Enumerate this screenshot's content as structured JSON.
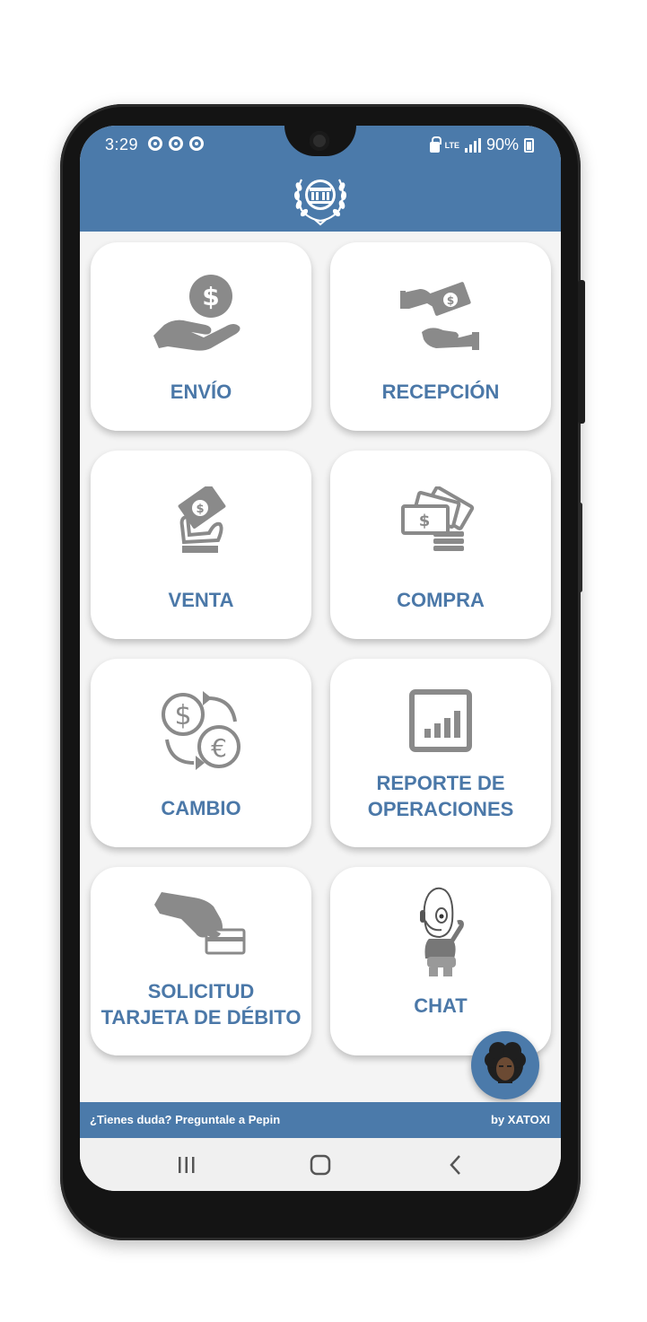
{
  "status_bar": {
    "time": "3:29",
    "network": "LTE",
    "battery": "90%"
  },
  "header": {
    "logo_icon": "institution-laurel-logo-icon"
  },
  "tiles": [
    {
      "label": "ENVÍO",
      "icon": "hand-money-icon"
    },
    {
      "label": "RECEPCIÓN",
      "icon": "money-handover-icon"
    },
    {
      "label": "VENTA",
      "icon": "sell-banknote-icon"
    },
    {
      "label": "COMPRA",
      "icon": "banknotes-coins-icon"
    },
    {
      "label": "CAMBIO",
      "icon": "currency-exchange-icon"
    },
    {
      "label": "REPORTE DE\nOPERACIONES",
      "icon": "bar-chart-icon"
    },
    {
      "label": "SOLICITUD\nTARJETA DE DÉBITO",
      "icon": "debit-card-hand-icon"
    },
    {
      "label": "CHAT",
      "icon": "chatbot-mascot-icon"
    }
  ],
  "fab": {
    "icon": "pepin-avatar-icon"
  },
  "footer": {
    "left_text": "¿Tienes duda? Preguntale a Pepin",
    "right_text": "by XATOXI"
  },
  "nav": {
    "recents_icon": "recents-icon",
    "home_icon": "home-icon",
    "back_icon": "back-icon"
  },
  "colors": {
    "brand": "#4b7aaa",
    "label": "#4b78a8",
    "icon_gray": "#8a8a8a"
  }
}
